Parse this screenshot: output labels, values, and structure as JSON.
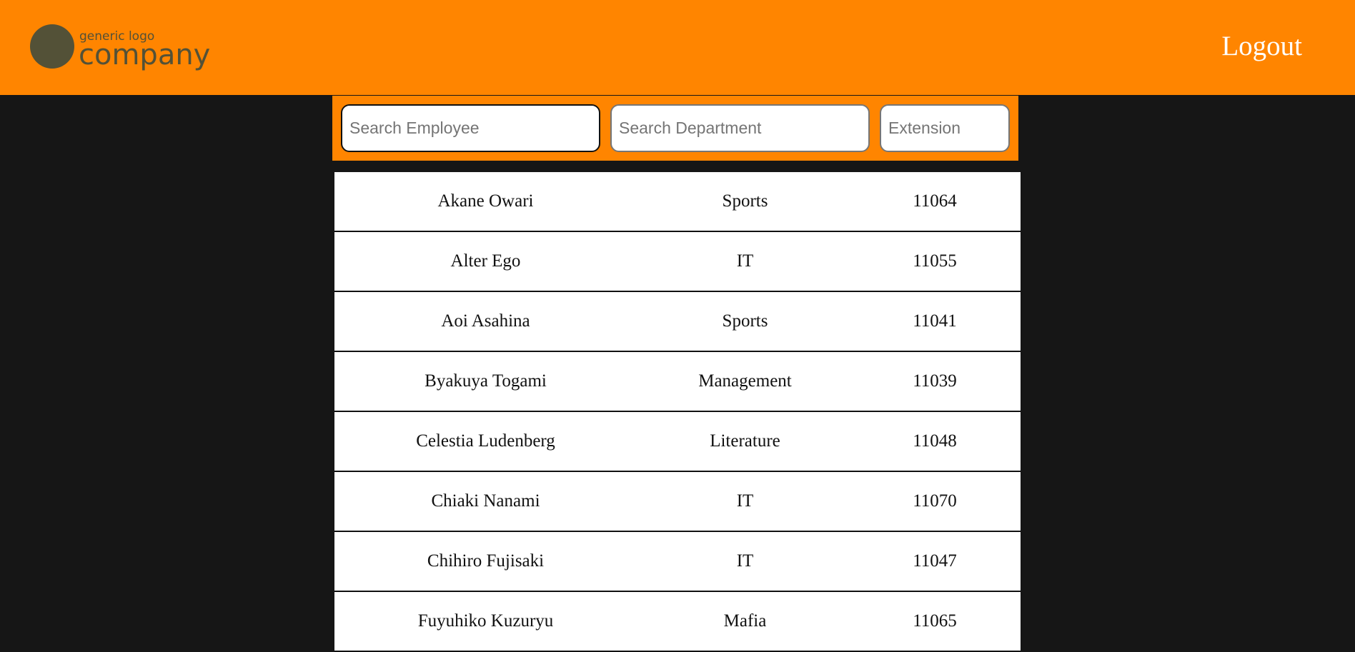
{
  "header": {
    "logo": {
      "small_text": "generic logo",
      "big_text": "company"
    },
    "logout_label": "Logout"
  },
  "search": {
    "employee_placeholder": "Search Employee",
    "department_placeholder": "Search Department",
    "extension_placeholder": "Extension"
  },
  "colors": {
    "accent": "#ff8500",
    "background": "#161616",
    "logo": "#535137"
  },
  "employees": [
    {
      "name": "Akane Owari",
      "department": "Sports",
      "extension": "11064"
    },
    {
      "name": "Alter Ego",
      "department": "IT",
      "extension": "11055"
    },
    {
      "name": "Aoi Asahina",
      "department": "Sports",
      "extension": "11041"
    },
    {
      "name": "Byakuya Togami",
      "department": "Management",
      "extension": "11039"
    },
    {
      "name": "Celestia Ludenberg",
      "department": "Literature",
      "extension": "11048"
    },
    {
      "name": "Chiaki Nanami",
      "department": "IT",
      "extension": "11070"
    },
    {
      "name": "Chihiro Fujisaki",
      "department": "IT",
      "extension": "11047"
    },
    {
      "name": "Fuyuhiko Kuzuryu",
      "department": "Mafia",
      "extension": "11065"
    }
  ]
}
